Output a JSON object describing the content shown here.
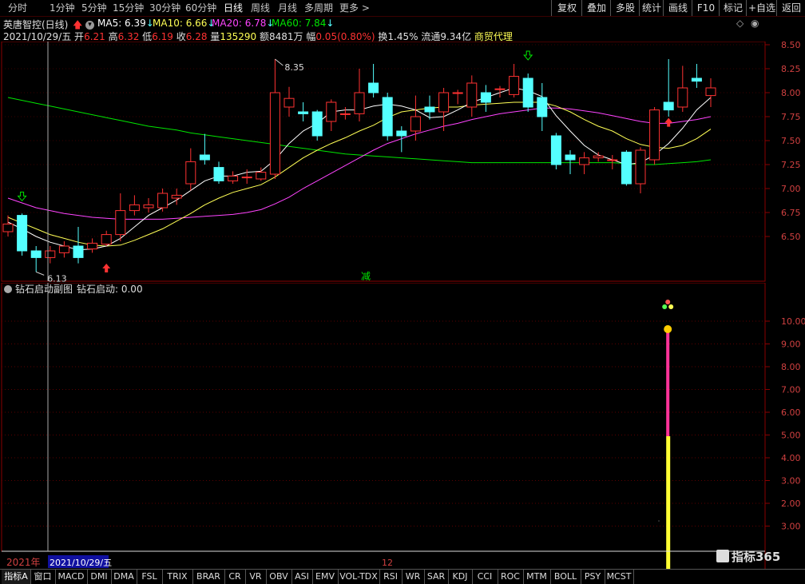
{
  "toolbar": {
    "periods": [
      "分时",
      "1分钟",
      "5分钟",
      "15分钟",
      "30分钟",
      "60分钟",
      "日线",
      "周线",
      "月线",
      "多周期",
      "更多"
    ],
    "active_period": "日线",
    "buttons": [
      "复权",
      "叠加",
      "多股",
      "统计",
      "画线",
      "F10",
      "标记",
      "+自选",
      "返回"
    ]
  },
  "header": {
    "stock_name": "英唐智控(日线)",
    "ma5": "MA5: 6.39",
    "ma10": "MA10: 6.66",
    "ma20": "MA20: 6.78",
    "ma60": "MA60: 7.84",
    "date": "2021/10/29/五",
    "open_label": "开",
    "open": "6.21",
    "high_label": "高",
    "high": "6.32",
    "low_label": "低",
    "low": "6.19",
    "close_label": "收",
    "close": "6.28",
    "vol_label": "量",
    "vol": "135290",
    "amt_label": "额",
    "amt": "8481万",
    "chg_label": "幅",
    "chg": "0.05(0.80%)",
    "turnover": "换1.45%",
    "float": "流通9.34亿",
    "sector": "商贸代理"
  },
  "colors": {
    "up": "#ff3232",
    "down": "#54ffff",
    "ma5": "#ffffff",
    "ma10": "#ffff55",
    "ma20": "#ff44ff",
    "ma60": "#00e600",
    "grid": "#8a0000"
  },
  "main_chart": {
    "price_ticks": [
      "8.50",
      "8.25",
      "8.00",
      "7.75",
      "7.50",
      "7.25",
      "7.00",
      "6.75",
      "6.50"
    ],
    "high_marker": "8.35",
    "low_marker": "6.13",
    "center_mark": "减"
  },
  "sub_chart": {
    "title": "钻石启动副图",
    "value_label": "钻石启动: 0.00",
    "ticks": [
      "10.00",
      "9.00",
      "8.00",
      "7.00",
      "6.00",
      "5.00",
      "4.00",
      "3.00",
      "2.00",
      "3.00"
    ]
  },
  "time_axis": {
    "year": "2021年",
    "cursor_date": "2021/10/29/五",
    "month": "12"
  },
  "bottom_tabs": [
    "指标A",
    "窗口",
    "MACD",
    "DMI",
    "DMA",
    "FSL",
    "TRIX",
    "BRAR",
    "CR",
    "VR",
    "OBV",
    "ASI",
    "EMV",
    "VOL-TDX",
    "RSI",
    "WR",
    "SAR",
    "KDJ",
    "CCI",
    "ROC",
    "MTM",
    "BOLL",
    "PSY",
    "MCST"
  ],
  "watermark": "指标365",
  "chart_data": {
    "type": "candlestick",
    "title": "英唐智控(日线)",
    "ylim": [
      6.1,
      8.6
    ],
    "candles": [
      {
        "o": 6.55,
        "c": 6.63,
        "h": 6.72,
        "l": 6.5
      },
      {
        "o": 6.72,
        "c": 6.35,
        "h": 6.74,
        "l": 6.3
      },
      {
        "o": 6.35,
        "c": 6.28,
        "h": 6.4,
        "l": 6.13
      },
      {
        "o": 6.28,
        "c": 6.35,
        "h": 6.4,
        "l": 6.22
      },
      {
        "o": 6.33,
        "c": 6.4,
        "h": 6.45,
        "l": 6.28
      },
      {
        "o": 6.4,
        "c": 6.28,
        "h": 6.6,
        "l": 6.22
      },
      {
        "o": 6.37,
        "c": 6.43,
        "h": 6.48,
        "l": 6.33
      },
      {
        "o": 6.42,
        "c": 6.52,
        "h": 6.56,
        "l": 6.4
      },
      {
        "o": 6.52,
        "c": 6.77,
        "h": 6.95,
        "l": 6.45
      },
      {
        "o": 6.77,
        "c": 6.83,
        "h": 6.93,
        "l": 6.72
      },
      {
        "o": 6.8,
        "c": 6.83,
        "h": 6.9,
        "l": 6.75
      },
      {
        "o": 6.8,
        "c": 6.95,
        "h": 7.0,
        "l": 6.76
      },
      {
        "o": 6.9,
        "c": 6.93,
        "h": 7.0,
        "l": 6.83
      },
      {
        "o": 7.05,
        "c": 7.28,
        "h": 7.42,
        "l": 6.98
      },
      {
        "o": 7.35,
        "c": 7.3,
        "h": 7.57,
        "l": 7.25
      },
      {
        "o": 7.22,
        "c": 7.08,
        "h": 7.28,
        "l": 7.05
      },
      {
        "o": 7.08,
        "c": 7.13,
        "h": 7.18,
        "l": 7.05
      },
      {
        "o": 7.12,
        "c": 7.12,
        "h": 7.2,
        "l": 7.05
      },
      {
        "o": 7.1,
        "c": 7.17,
        "h": 7.22,
        "l": 7.08
      },
      {
        "o": 7.15,
        "c": 8.0,
        "h": 8.35,
        "l": 7.1
      },
      {
        "o": 7.85,
        "c": 7.94,
        "h": 8.06,
        "l": 7.75
      },
      {
        "o": 7.8,
        "c": 7.78,
        "h": 7.9,
        "l": 7.7
      },
      {
        "o": 7.8,
        "c": 7.55,
        "h": 7.82,
        "l": 7.5
      },
      {
        "o": 7.7,
        "c": 7.9,
        "h": 7.93,
        "l": 7.6
      },
      {
        "o": 7.78,
        "c": 7.78,
        "h": 7.85,
        "l": 7.72
      },
      {
        "o": 7.78,
        "c": 8.0,
        "h": 8.25,
        "l": 7.7
      },
      {
        "o": 8.1,
        "c": 8.0,
        "h": 8.3,
        "l": 7.95
      },
      {
        "o": 7.95,
        "c": 7.55,
        "h": 8.0,
        "l": 7.5
      },
      {
        "o": 7.6,
        "c": 7.55,
        "h": 7.65,
        "l": 7.38
      },
      {
        "o": 7.6,
        "c": 7.75,
        "h": 7.97,
        "l": 7.5
      },
      {
        "o": 7.85,
        "c": 7.8,
        "h": 7.97,
        "l": 7.72
      },
      {
        "o": 7.8,
        "c": 8.0,
        "h": 8.05,
        "l": 7.6
      },
      {
        "o": 8.0,
        "c": 8.0,
        "h": 8.03,
        "l": 7.88
      },
      {
        "o": 7.85,
        "c": 8.1,
        "h": 8.18,
        "l": 7.75
      },
      {
        "o": 8.0,
        "c": 7.9,
        "h": 8.08,
        "l": 7.8
      },
      {
        "o": 8.04,
        "c": 8.04,
        "h": 8.07,
        "l": 7.95
      },
      {
        "o": 7.98,
        "c": 8.17,
        "h": 8.3,
        "l": 7.95
      },
      {
        "o": 8.15,
        "c": 7.85,
        "h": 8.2,
        "l": 7.8
      },
      {
        "o": 7.95,
        "c": 7.75,
        "h": 8.1,
        "l": 7.6
      },
      {
        "o": 7.55,
        "c": 7.25,
        "h": 7.58,
        "l": 7.2
      },
      {
        "o": 7.35,
        "c": 7.3,
        "h": 7.4,
        "l": 7.15
      },
      {
        "o": 7.25,
        "c": 7.32,
        "h": 7.38,
        "l": 7.15
      },
      {
        "o": 7.32,
        "c": 7.34,
        "h": 7.38,
        "l": 7.28
      },
      {
        "o": 7.3,
        "c": 7.3,
        "h": 7.35,
        "l": 7.2
      },
      {
        "o": 7.38,
        "c": 7.05,
        "h": 7.4,
        "l": 7.03
      },
      {
        "o": 7.05,
        "c": 7.4,
        "h": 7.43,
        "l": 6.95
      },
      {
        "o": 7.3,
        "c": 7.82,
        "h": 7.85,
        "l": 7.25
      },
      {
        "o": 7.9,
        "c": 7.82,
        "h": 8.35,
        "l": 7.75
      },
      {
        "o": 7.85,
        "c": 8.05,
        "h": 8.28,
        "l": 7.8
      },
      {
        "o": 8.15,
        "c": 8.12,
        "h": 8.3,
        "l": 8.05
      },
      {
        "o": 7.97,
        "c": 8.05,
        "h": 8.15,
        "l": 7.85
      }
    ],
    "ma5": [
      6.65,
      6.58,
      6.5,
      6.44,
      6.4,
      6.36,
      6.37,
      6.4,
      6.48,
      6.6,
      6.72,
      6.8,
      6.88,
      6.98,
      7.08,
      7.13,
      7.13,
      7.17,
      7.18,
      7.3,
      7.47,
      7.6,
      7.68,
      7.8,
      7.82,
      7.82,
      7.86,
      7.88,
      7.86,
      7.82,
      7.74,
      7.75,
      7.82,
      7.9,
      7.95,
      8.0,
      8.05,
      8.02,
      7.96,
      7.76,
      7.6,
      7.45,
      7.35,
      7.3,
      7.25,
      7.27,
      7.35,
      7.47,
      7.63,
      7.82,
      7.95
    ],
    "ma10": [
      6.7,
      6.64,
      6.58,
      6.52,
      6.48,
      6.44,
      6.41,
      6.4,
      6.41,
      6.46,
      6.52,
      6.58,
      6.66,
      6.74,
      6.83,
      6.9,
      6.96,
      7.0,
      7.04,
      7.12,
      7.22,
      7.32,
      7.4,
      7.47,
      7.53,
      7.6,
      7.66,
      7.74,
      7.8,
      7.82,
      7.84,
      7.85,
      7.85,
      7.87,
      7.88,
      7.89,
      7.9,
      7.9,
      7.9,
      7.86,
      7.8,
      7.72,
      7.65,
      7.6,
      7.52,
      7.46,
      7.43,
      7.42,
      7.45,
      7.52,
      7.62
    ],
    "ma20": [
      6.9,
      6.85,
      6.8,
      6.77,
      6.74,
      6.72,
      6.7,
      6.69,
      6.68,
      6.68,
      6.68,
      6.68,
      6.69,
      6.7,
      6.71,
      6.72,
      6.73,
      6.75,
      6.78,
      6.84,
      6.91,
      7.0,
      7.08,
      7.16,
      7.24,
      7.32,
      7.4,
      7.47,
      7.52,
      7.57,
      7.61,
      7.65,
      7.68,
      7.72,
      7.75,
      7.78,
      7.8,
      7.82,
      7.84,
      7.84,
      7.83,
      7.81,
      7.79,
      7.76,
      7.73,
      7.7,
      7.68,
      7.68,
      7.7,
      7.72,
      7.75
    ],
    "ma60": [
      7.95,
      7.92,
      7.89,
      7.86,
      7.83,
      7.8,
      7.77,
      7.74,
      7.71,
      7.68,
      7.65,
      7.63,
      7.61,
      7.58,
      7.56,
      7.54,
      7.52,
      7.5,
      7.48,
      7.46,
      7.44,
      7.42,
      7.4,
      7.38,
      7.36,
      7.35,
      7.34,
      7.33,
      7.32,
      7.31,
      7.3,
      7.29,
      7.28,
      7.27,
      7.27,
      7.27,
      7.27,
      7.27,
      7.27,
      7.27,
      7.27,
      7.27,
      7.27,
      7.27,
      7.26,
      7.25,
      7.25,
      7.26,
      7.27,
      7.28,
      7.3
    ],
    "signal_index": 47,
    "signal_value": 9.7,
    "signal_split": 5.0,
    "sub_ylim": [
      1.8,
      11.0
    ]
  }
}
